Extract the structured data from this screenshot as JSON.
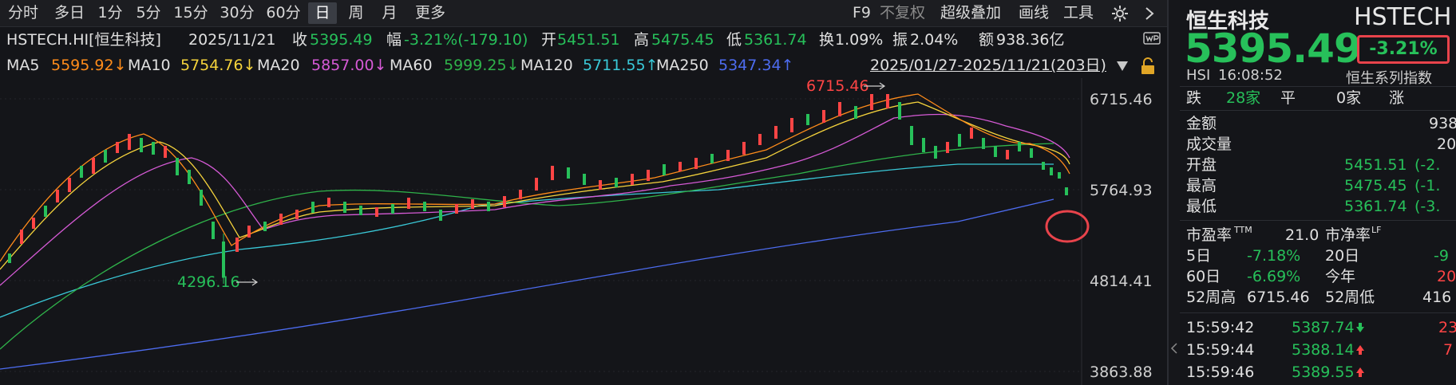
{
  "toolbar": {
    "periods": [
      "分时",
      "多日",
      "1分",
      "5分",
      "15分",
      "30分",
      "60分",
      "日",
      "周",
      "月",
      "更多"
    ],
    "active_period": "日",
    "right_items": [
      "F9",
      "不复权",
      "超级叠加",
      "画线",
      "工具"
    ]
  },
  "info": {
    "symbol": "HSTECH.HI[恒生科技]",
    "date": "2025/11/21",
    "close_label": "收",
    "close_value": "5395.49",
    "change_label": "幅",
    "change_value": "-3.21%(-179.10)",
    "open_label": "开",
    "open_value": "5451.51",
    "high_label": "高",
    "high_value": "5475.45",
    "low_label": "低",
    "low_value": "5361.74",
    "turnover_label": "换",
    "turnover_value": "1.09%",
    "amplitude_label": "振",
    "amplitude_value": "2.04%",
    "amount_label": "额",
    "amount_value": "938.36亿"
  },
  "ma": {
    "ma5": {
      "label": "MA5",
      "value": "5595.92↓",
      "color": "#ff8c1a"
    },
    "ma10": {
      "label": "MA10",
      "value": "5754.76↓",
      "color": "#f5d33c"
    },
    "ma20": {
      "label": "MA20",
      "value": "5857.00↓",
      "color": "#d65ad6"
    },
    "ma60": {
      "label": "MA60",
      "value": "5999.25↓",
      "color": "#2fb34a"
    },
    "ma120": {
      "label": "MA120",
      "value": "5711.55↑",
      "color": "#3ac9d8"
    },
    "ma250": {
      "label": "MA250",
      "value": "5347.34↑",
      "color": "#4d6cf0"
    },
    "range": "2025/01/27-2025/11/21(203日)"
  },
  "chart": {
    "y_ticks": [
      "6715.46",
      "5764.93",
      "4814.41",
      "3863.88"
    ],
    "high_marker": "6715.46",
    "low_marker": "4296.16"
  },
  "side": {
    "name": "恒生科技",
    "code": "HSTECH",
    "price": "5395.49",
    "change_pct": "-3.21%",
    "exchange": "HSI",
    "time": "16:08:52",
    "series": "恒生系列指数",
    "breadth": {
      "down_label": "跌",
      "down_count": "28家",
      "flat_label": "平",
      "flat_count": "0家",
      "up_label": "涨"
    },
    "amount_label": "金额",
    "amount_value": "938",
    "volume_label": "成交量",
    "volume_value": "20",
    "open_label": "开盘",
    "open_value": "5451.51",
    "open_pct": "(-2.",
    "high_label": "最高",
    "high_value": "5475.45",
    "high_pct": "(-1.",
    "low_label": "最低",
    "low_value": "5361.74",
    "low_pct": "(-3.",
    "pe_label": "市盈率",
    "pe_sup": "TTM",
    "pe_value": "21.0",
    "pb_label": "市净率",
    "pb_sup": "LF",
    "d5_label": "5日",
    "d5_value": "-7.18%",
    "d20_label": "20日",
    "d20_value": "-9",
    "d60_label": "60日",
    "d60_value": "-6.69%",
    "ytd_label": "今年",
    "ytd_value": "20",
    "w52h_label": "52周高",
    "w52h_value": "6715.46",
    "w52l_label": "52周低",
    "w52l_value": "416",
    "ticks": [
      {
        "time": "15:59:42",
        "price": "5387.74",
        "dir": "down",
        "extra": "23"
      },
      {
        "time": "15:59:44",
        "price": "5388.14",
        "dir": "up",
        "extra": "7"
      },
      {
        "time": "15:59:46",
        "price": "5389.55",
        "dir": "up",
        "extra": ""
      }
    ]
  },
  "chart_data": {
    "type": "candlestick",
    "y_axis_ticks": [
      6715.46,
      5764.93,
      4814.41,
      3863.88
    ],
    "last_close": 5395.49,
    "period_high": 6715.46,
    "period_low": 4296.16,
    "moving_averages": {
      "MA5": 5595.92,
      "MA10": 5754.76,
      "MA20": 5857.0,
      "MA60": 5999.25,
      "MA120": 5711.55,
      "MA250": 5347.34
    }
  }
}
